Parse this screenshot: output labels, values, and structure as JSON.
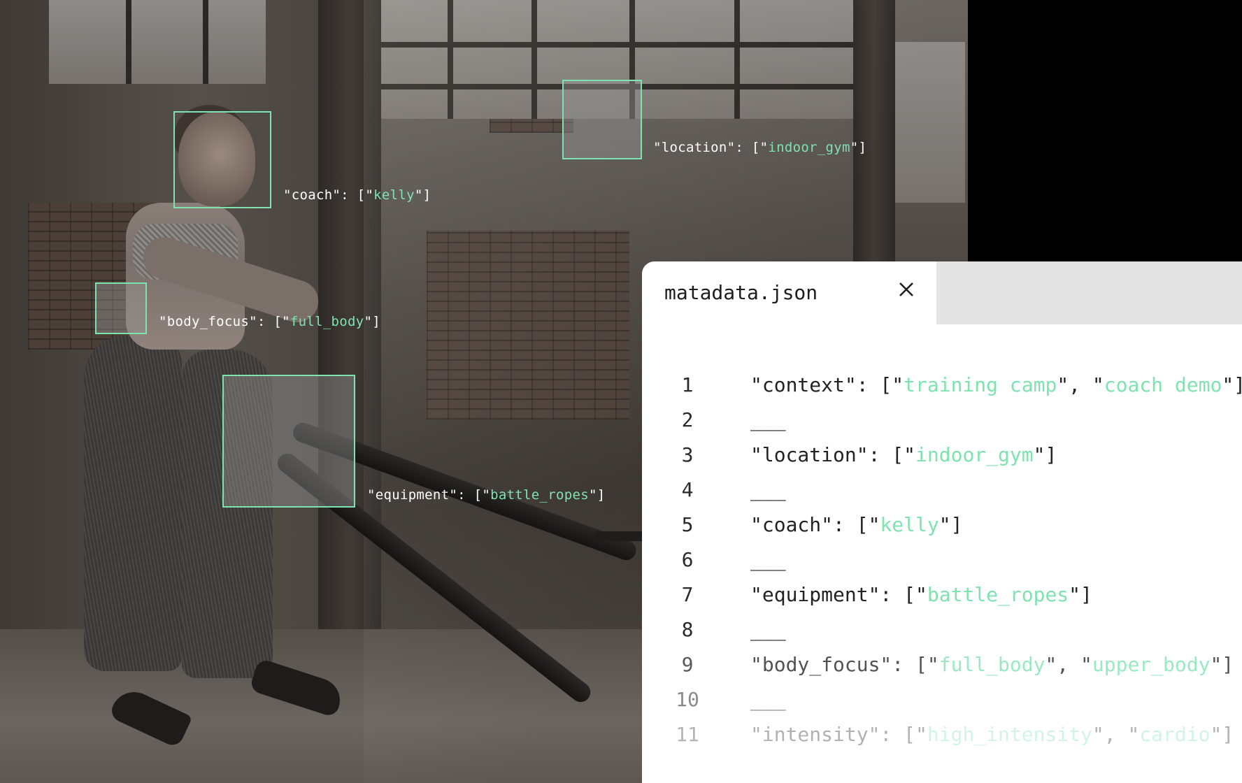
{
  "scene": {
    "annotations": [
      {
        "key": "\"coach\": [\"",
        "val": "kelly",
        "end": "\"]"
      },
      {
        "key": "\"location\": [\"",
        "val": "indoor_gym",
        "end": "\"]"
      },
      {
        "key": "\"body_focus\": [\"",
        "val": "full_body",
        "end": "\"]"
      },
      {
        "key": "\"equipment\": [\"",
        "val": "battle_ropes",
        "end": "\"]"
      }
    ]
  },
  "panel": {
    "tab_title": "matadata.json",
    "close_icon": "close-icon",
    "lines": [
      {
        "num": "1",
        "parts": [
          {
            "t": "\"context\": [\"",
            "c": "k"
          },
          {
            "t": "training camp",
            "c": "v"
          },
          {
            "t": "\", \"",
            "c": "k"
          },
          {
            "t": "coach demo",
            "c": "v"
          },
          {
            "t": "\"]",
            "c": "k"
          }
        ]
      },
      {
        "num": "2",
        "parts": [
          {
            "t": "___",
            "c": "k"
          }
        ]
      },
      {
        "num": "3",
        "parts": [
          {
            "t": "\"location\": [\"",
            "c": "k"
          },
          {
            "t": "indoor_gym",
            "c": "v"
          },
          {
            "t": "\"]",
            "c": "k"
          }
        ]
      },
      {
        "num": "4",
        "parts": [
          {
            "t": "___",
            "c": "k"
          }
        ]
      },
      {
        "num": "5",
        "parts": [
          {
            "t": "\"coach\": [\"",
            "c": "k"
          },
          {
            "t": "kelly",
            "c": "v"
          },
          {
            "t": "\"]",
            "c": "k"
          }
        ]
      },
      {
        "num": "6",
        "parts": [
          {
            "t": "___",
            "c": "k"
          }
        ]
      },
      {
        "num": "7",
        "parts": [
          {
            "t": "\"equipment\": [\"",
            "c": "k"
          },
          {
            "t": "battle_ropes",
            "c": "v"
          },
          {
            "t": "\"]",
            "c": "k"
          }
        ]
      },
      {
        "num": "8",
        "parts": [
          {
            "t": "___",
            "c": "k"
          }
        ]
      },
      {
        "num": "9",
        "parts": [
          {
            "t": "\"body_focus\": [\"",
            "c": "k"
          },
          {
            "t": "full_body",
            "c": "v"
          },
          {
            "t": "\", \"",
            "c": "k"
          },
          {
            "t": "upper_body",
            "c": "v"
          },
          {
            "t": "\"]",
            "c": "k"
          }
        ]
      },
      {
        "num": "10",
        "parts": [
          {
            "t": "___",
            "c": "k"
          }
        ]
      },
      {
        "num": "11",
        "parts": [
          {
            "t": "\"intensity\": [\"",
            "c": "k"
          },
          {
            "t": "high_intensity",
            "c": "v"
          },
          {
            "t": "\", \"",
            "c": "k"
          },
          {
            "t": "cardio",
            "c": "v"
          },
          {
            "t": "\"]",
            "c": "k"
          }
        ]
      }
    ]
  },
  "colors": {
    "accent": "#7fe3b0",
    "panel_bg": "#ffffff",
    "tabbar_bg": "#e4e4e4",
    "code_text": "#222222"
  }
}
